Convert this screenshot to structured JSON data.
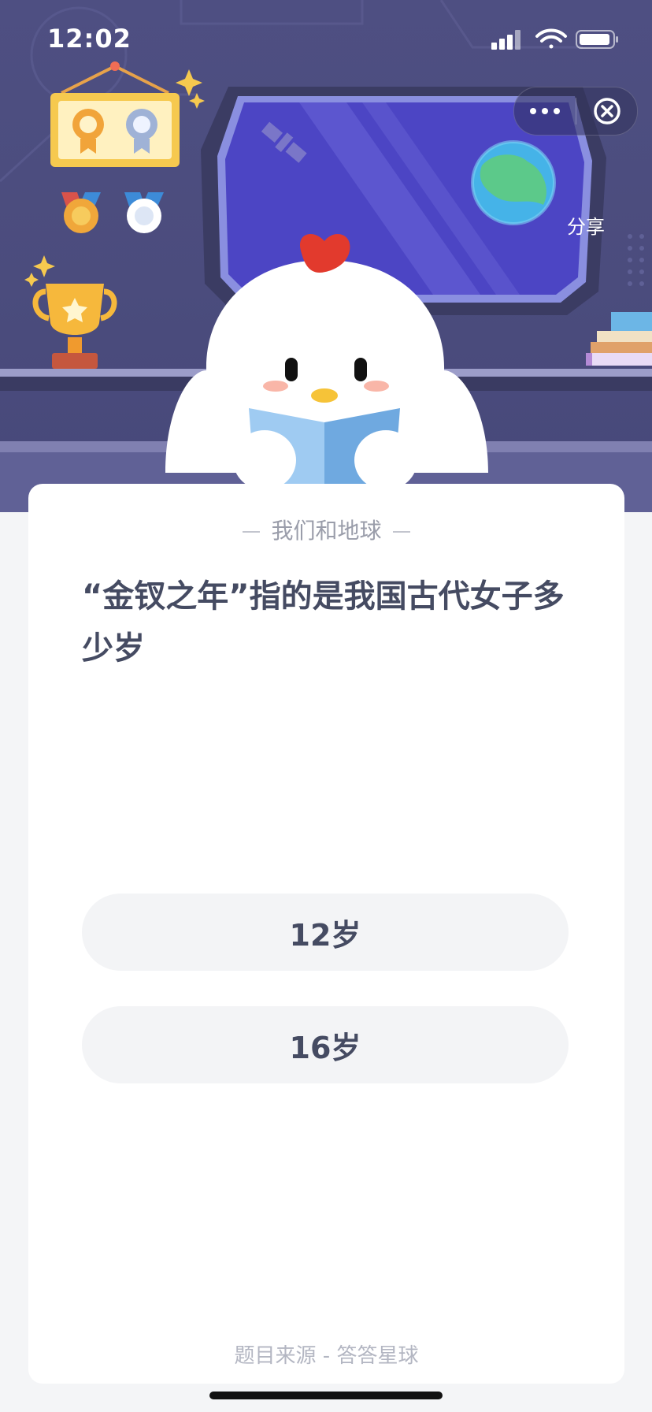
{
  "status_bar": {
    "time": "12:02"
  },
  "capsule": {
    "share_label": "分享"
  },
  "quiz": {
    "category": "我们和地球",
    "question": "“金钗之年”指的是我国古代女子多少岁",
    "options": [
      {
        "label": "12岁"
      },
      {
        "label": "16岁"
      }
    ],
    "source": "题目来源 - 答答星球"
  },
  "colors": {
    "hero_bg": "#4e4f82",
    "page_bg": "#f4f5f7",
    "question_text": "#454b62",
    "option_bg": "#f3f4f6",
    "muted_text": "#9a9daa"
  },
  "icons": [
    "signal-icon",
    "wifi-icon",
    "battery-icon",
    "more-dots-icon",
    "close-icon",
    "earth-icon",
    "trophy-icon",
    "medal-icon",
    "satellite-icon"
  ]
}
